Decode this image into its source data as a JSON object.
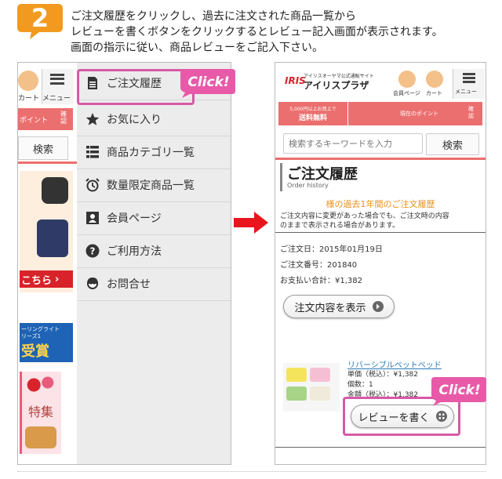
{
  "step": {
    "number": "2"
  },
  "instructions": {
    "line1": "ご注文履歴をクリックし、過去に注文された商品一覧から",
    "line2": "レビューを書くボタンをクリックするとレビュー記入画面が表示されます。",
    "line3": "画面の指示に従い、商品レビューをご記入下さい。"
  },
  "left_phone": {
    "bg": {
      "cart_label": "カート",
      "menu_label": "メニュー",
      "points_text": "ポイント",
      "confirm_text": "確\n認",
      "search_label": "検索",
      "banner_kochira": "こちら",
      "banner_led": "ーリングライト",
      "banner_series": "リーズ1",
      "banner_award": "受賞",
      "banner_toku": "特集"
    },
    "menu_items": [
      {
        "label": "ご注文履歴",
        "icon": "document-icon"
      },
      {
        "label": "お気に入り",
        "icon": "star-icon"
      },
      {
        "label": "商品カテゴリ一覧",
        "icon": "list-icon"
      },
      {
        "label": "数量限定商品一覧",
        "icon": "alarm-clock-icon"
      },
      {
        "label": "会員ページ",
        "icon": "member-card-icon"
      },
      {
        "label": "ご利用方法",
        "icon": "question-icon"
      },
      {
        "label": "お問合せ",
        "icon": "support-agent-icon"
      }
    ],
    "click_label": "Click!"
  },
  "right_phone": {
    "logo_sub": "アイリスオーヤマ公式通販サイト",
    "logo_main": "アイリスプラザ",
    "logo_iris": "IRIS",
    "member_label": "会員ページ",
    "cart_label": "カート",
    "menu_label": "メニュー",
    "free_shipping_top": "5,000円以上お買上で",
    "free_shipping_bottom": "送料無料",
    "points_label": "現在のポイント",
    "confirm_text": "確\n認",
    "search_placeholder": "検索するキーワードを入力",
    "search_label": "検索",
    "page_title": "ご注文履歴",
    "page_subtitle": "Order history",
    "history_heading": "様の過去1年間のご注文履歴",
    "notice_line1": "ご注文内容に変更があった場合でも、ご注文時の内容",
    "notice_line2": "のままで表示される場合があります。",
    "order_date": "ご注文日：2015年01月19日",
    "order_number": "ご注文番号：201840",
    "order_total": "お支払い合計：¥1,382",
    "view_order_button": "注文内容を表示",
    "product_name": "リバーシブルペットベッド",
    "unit_price": "単価（税込）：¥1,382",
    "quantity": "個数：1",
    "amount": "金額（税込）：¥1,382",
    "review_button": "レビューを書く",
    "click_label": "Click!"
  },
  "colors": {
    "accent_orange": "#f08a1c",
    "pink_frame": "#d65aa6",
    "header_red": "#ec6f6f",
    "arrow_red": "#e8161c",
    "heading_orange": "#e8901a"
  }
}
